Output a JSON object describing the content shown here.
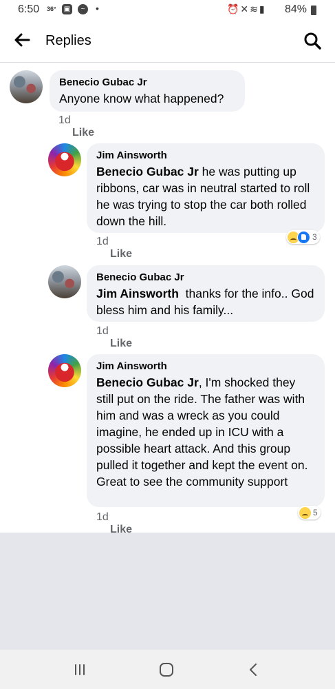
{
  "status_bar": {
    "time": "6:50",
    "temperature": "36°",
    "battery": "84%"
  },
  "header": {
    "title": "Replies"
  },
  "comments": [
    {
      "author": "Benecio Gubac Jr",
      "mention": "",
      "text": "Anyone know what happened?",
      "time": "1d",
      "like_label": "Like"
    },
    {
      "author": "Jim Ainsworth",
      "mention": "Benecio Gubac Jr",
      "text": " he was putting up ribbons, car was in neutral started to roll he was trying to stop the car both rolled down the hill.",
      "time": "1d",
      "like_label": "Like",
      "reactions": [
        "sad",
        "like"
      ],
      "reaction_count": "3"
    },
    {
      "author": "Benecio Gubac Jr",
      "mention": "Jim Ainsworth",
      "text": "  thanks for the info.. God bless him and his family...",
      "time": "1d",
      "like_label": "Like"
    },
    {
      "author": "Jim Ainsworth",
      "mention": "Benecio Gubac Jr",
      "text": ", I'm shocked they still put on the ride. The father was with him and was a wreck as you could imagine, he ended up in ICU with a possible heart attack. And this group pulled it together and kept the event on.\nGreat to see the community support",
      "time": "1d",
      "like_label": "Like",
      "reactions": [
        "sad"
      ],
      "reaction_count": "5"
    }
  ],
  "icons": {
    "back": "arrow-left-icon",
    "search": "magnifier-icon",
    "nav_recents": "recents-icon",
    "nav_home": "home-icon",
    "nav_back": "chevron-left-icon"
  },
  "colors": {
    "bubble": "#f0f2f5",
    "meta_text": "#65676b",
    "like_blue": "#1877f2"
  }
}
